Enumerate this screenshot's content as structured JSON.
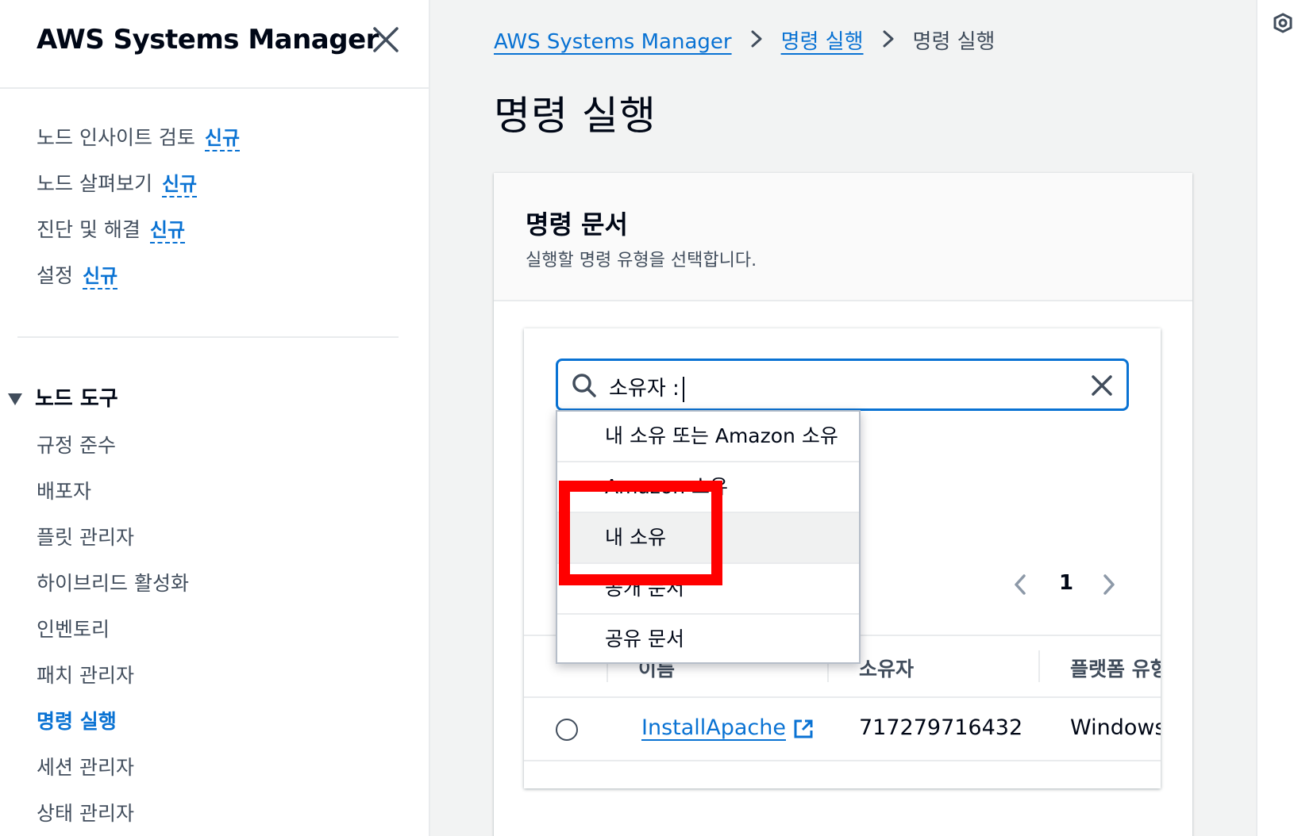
{
  "sidebar": {
    "title": "AWS Systems Manager",
    "top_items": [
      {
        "label": "노드 인사이트 검토",
        "badge": "신규"
      },
      {
        "label": "노드 살펴보기",
        "badge": "신규"
      },
      {
        "label": "진단 및 해결",
        "badge": "신규"
      },
      {
        "label": "설정",
        "badge": "신규"
      }
    ],
    "section": "노드 도구",
    "tools": [
      "규정 준수",
      "배포자",
      "플릿 관리자",
      "하이브리드 활성화",
      "인벤토리",
      "패치 관리자",
      "명령 실행",
      "세션 관리자",
      "상태 관리자"
    ],
    "active_tool": "명령 실행"
  },
  "breadcrumb": {
    "items": [
      "AWS Systems Manager",
      "명령 실행",
      "명령 실행"
    ]
  },
  "page": {
    "title": "명령 실행"
  },
  "card": {
    "title": "명령 문서",
    "description": "실행할 명령 유형을 선택합니다."
  },
  "search": {
    "value": "소유자 :"
  },
  "dropdown": {
    "options": [
      "내 소유 또는 Amazon 소유",
      "Amazon 소유",
      "내 소유",
      "공개 문서",
      "공유 문서"
    ],
    "hovered_index": 2
  },
  "pagination": {
    "current_page": "1"
  },
  "table": {
    "headers": [
      "이름",
      "소유자",
      "플랫폼 유형"
    ],
    "rows": [
      {
        "name": "InstallApache",
        "owner": "717279716432",
        "platform": "Windows"
      }
    ]
  },
  "colors": {
    "link": "#0972d3",
    "highlight": "#ff0000"
  }
}
